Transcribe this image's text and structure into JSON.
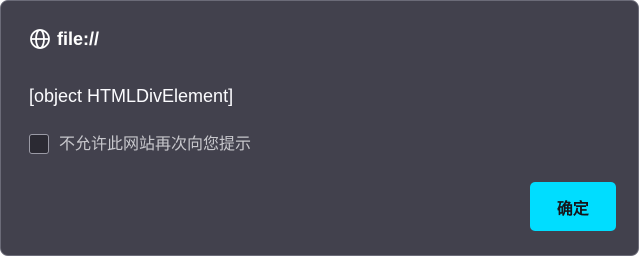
{
  "dialog": {
    "origin": "file://",
    "origin_icon": "globe-icon",
    "message": "[object HTMLDivElement]",
    "checkbox": {
      "label": "不允许此网站再次向您提示",
      "checked": false
    },
    "ok_label": "确定"
  },
  "colors": {
    "background": "#42414d",
    "button": "#00ddff",
    "text": "#fbfbfe"
  }
}
